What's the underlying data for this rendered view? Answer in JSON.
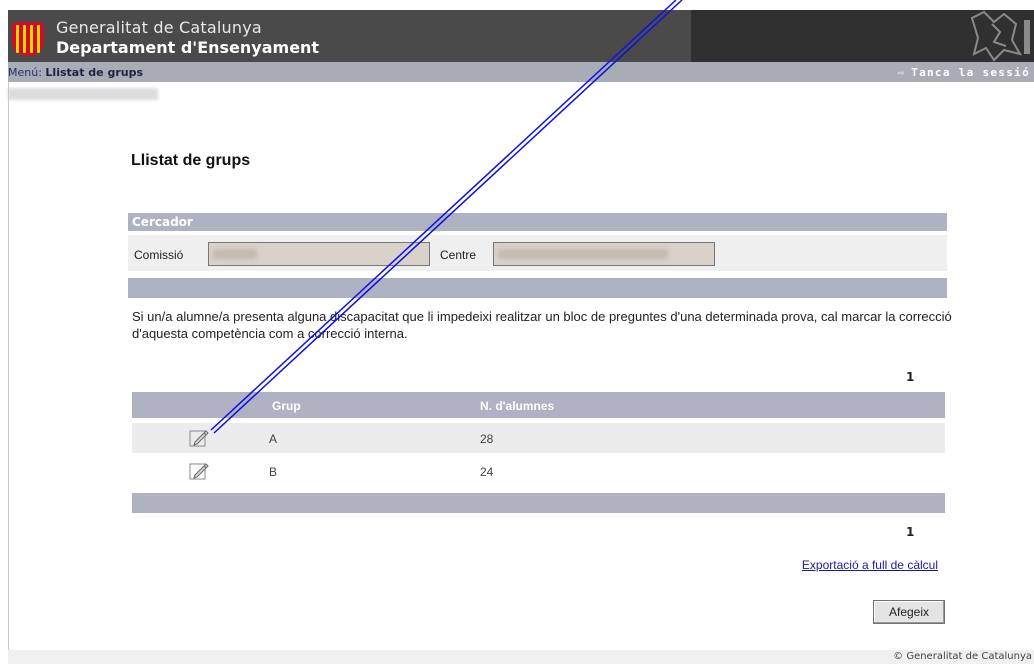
{
  "header": {
    "org_line1": "Generalitat de Catalunya",
    "org_line2": "Departament d'Ensenyament",
    "logo_icon": "catalonia-flag-shield-icon",
    "emblem_icon": "generalitat-emblem-icon"
  },
  "menubar": {
    "menu_prefix": "Menú:",
    "menu_current": "Llistat de grups",
    "logout_label": "Tanca la sessió",
    "logout_icon": "exit-icon"
  },
  "user_line": "",
  "page": {
    "title": "Llistat de grups"
  },
  "search": {
    "header": "Cercador",
    "comissio_label": "Comissió",
    "comissio_value": "",
    "centre_label": "Centre",
    "centre_value": ""
  },
  "notice": "Si un/a alumne/a presenta alguna discapacitat que li impedeixi realitzar un bloc de preguntes d'una determinada prova, cal marcar la correcció d'aquesta competència com a correcció interna.",
  "pager": {
    "top_page": "1",
    "bottom_page": "1"
  },
  "table": {
    "columns": [
      "",
      "Grup",
      "N. d'alumnes"
    ],
    "rows": [
      {
        "icon": "edit-pencil-icon",
        "grup": "A",
        "alumnes": "28"
      },
      {
        "icon": "edit-pencil-icon",
        "grup": "B",
        "alumnes": "24"
      }
    ]
  },
  "actions": {
    "export_label": "Exportació a full de càlcul",
    "add_label": "Afegeix"
  },
  "footer": {
    "copyright": "© Generalitat de Catalunya"
  },
  "colors": {
    "header_bg": "#4a4a4a",
    "bar_bg": "#aeb2c3",
    "menubar_bg": "#a8acb4",
    "annotation_line": "#1010e0"
  }
}
